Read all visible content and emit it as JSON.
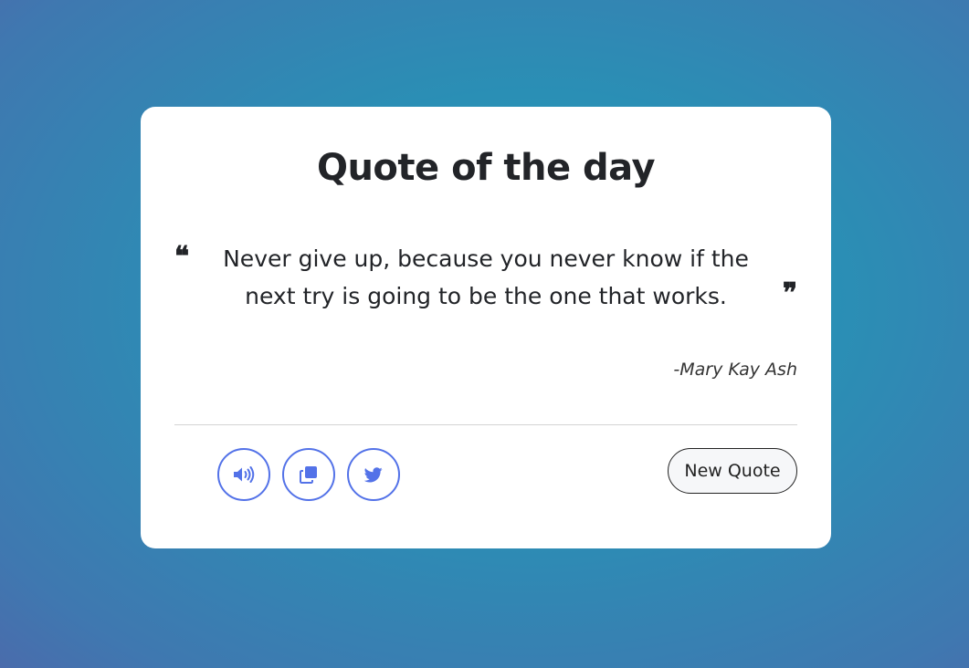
{
  "card": {
    "title": "Quote of the day",
    "quote": "Never give up, because you never know if the next try is going to be the one that works.",
    "author": "-Mary Kay Ash",
    "open_quote_mark": "❝",
    "close_quote_mark": "❞"
  },
  "actions": {
    "speak_icon": "volume-icon",
    "copy_icon": "copy-icon",
    "tweet_icon": "twitter-icon",
    "new_quote_label": "New Quote"
  },
  "colors": {
    "accent": "#5372e8",
    "text": "#222428",
    "background_start": "#1e9bb8",
    "background_end": "#4a6cac"
  }
}
